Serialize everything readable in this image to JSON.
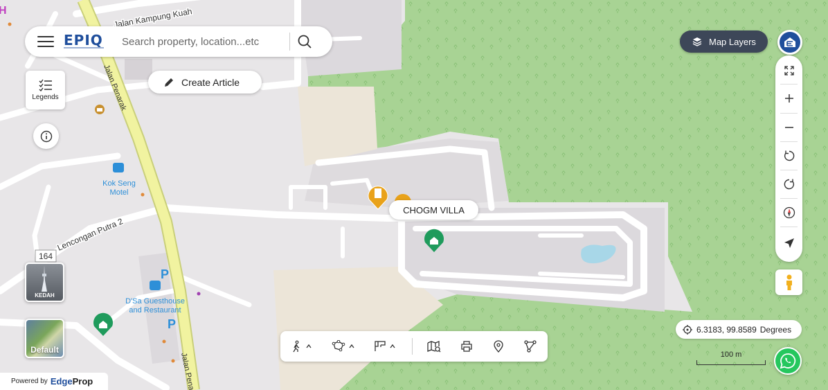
{
  "header": {
    "logo_text": "EPIQ",
    "search_placeholder": "Search property, location...etc"
  },
  "actions": {
    "create_article": "Create Article",
    "legends": "Legends",
    "map_layers": "Map Layers"
  },
  "basemaps": {
    "kedah_label": "KEDAH",
    "default_label": "Default"
  },
  "footer": {
    "powered_by": "Powered by",
    "brand_prefix": "Edge",
    "brand_suffix": "Prop"
  },
  "map": {
    "roads": [
      "Jalan Kampung Kuah",
      "Jalan Penarak",
      "Lencongan Putra 2",
      "Jalan Pena"
    ],
    "road_number": "164",
    "pois": [
      "Kok Seng\nMotel",
      "D'Sa Guesthouse\nand Restaurant"
    ],
    "parking_label": "P",
    "selected_property": "CHOGM VILLA",
    "colors": {
      "land": "#e8e6e8",
      "built": "#dcd9dd",
      "park": "#a8d394",
      "road": "#ffffff",
      "highway": "#f1f3a0",
      "highway_edge": "#c9cf7a",
      "sand": "#ece5d8",
      "water": "#a8d7e8",
      "poi_blue": "#2d8fd8",
      "pin_green": "#1f9b5c",
      "pin_orange": "#e9a21a"
    }
  },
  "coords": {
    "value": "6.3183, 99.8589",
    "unit": "Degrees"
  },
  "scale": {
    "label": "100 m"
  },
  "icons": {
    "menu": "hamburger-icon",
    "search": "search-icon",
    "pencil": "pencil-icon",
    "legend": "list-icon",
    "info": "info-icon",
    "layers": "layers-icon",
    "fullscreen": "expand-icon",
    "zoom_in": "plus-icon",
    "zoom_out": "minus-icon",
    "rotate_left": "rotate-ccw-icon",
    "rotate_right": "rotate-cw-icon",
    "compass": "compass-icon",
    "locate": "navigation-arrow-icon",
    "streetview": "pegman-icon",
    "whatsapp": "whatsapp-icon"
  }
}
